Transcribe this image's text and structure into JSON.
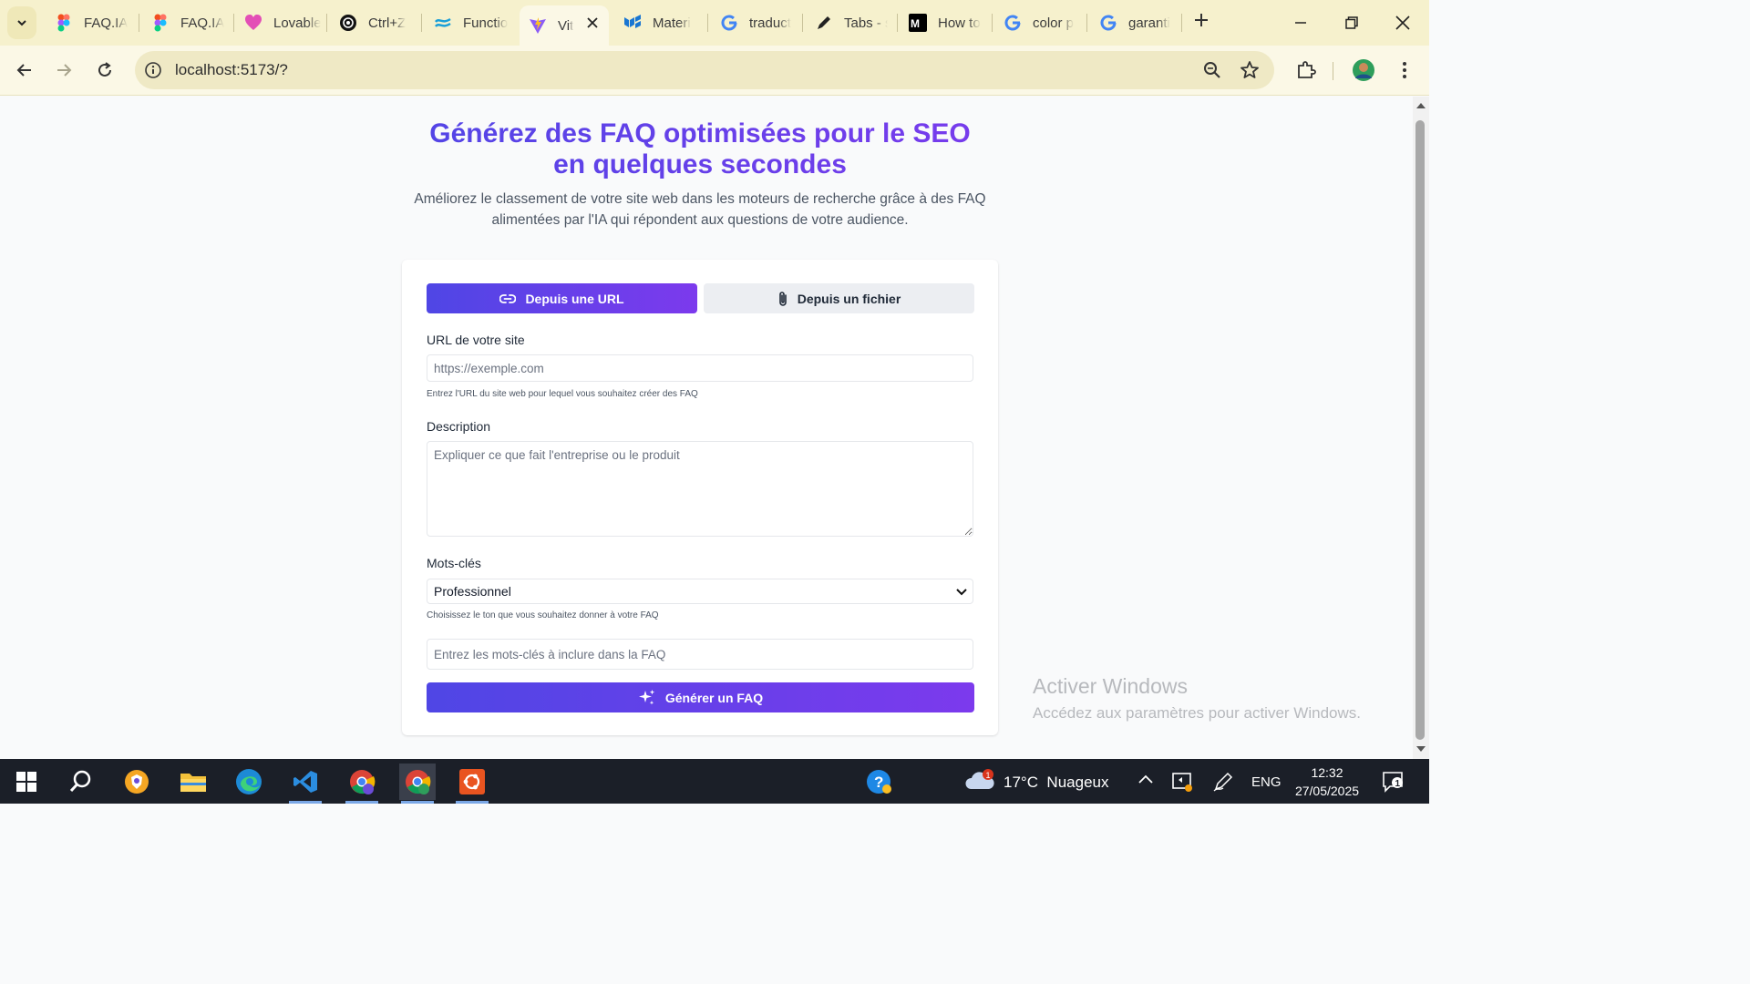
{
  "browser": {
    "tabs": [
      {
        "label": "FAQ.IA",
        "icon": "figma-icon"
      },
      {
        "label": "FAQ.IA",
        "icon": "figma-icon"
      },
      {
        "label": "Lovable",
        "icon": "lovable-icon"
      },
      {
        "label": "Ctrl+Z",
        "icon": "openai-icon"
      },
      {
        "label": "Functio",
        "icon": "wave-icon"
      },
      {
        "label": "Vit",
        "icon": "vite-icon",
        "active": true
      },
      {
        "label": "Materi",
        "icon": "mui-icon"
      },
      {
        "label": "traduct",
        "icon": "google-icon"
      },
      {
        "label": "Tabs - s",
        "icon": "pen-icon"
      },
      {
        "label": "How to",
        "icon": "medium-icon"
      },
      {
        "label": "color p",
        "icon": "google-icon"
      },
      {
        "label": "garanti",
        "icon": "google-icon"
      }
    ],
    "url": "localhost:5173/?"
  },
  "hero": {
    "title_line1": "Générez des FAQ optimisées pour le SEO",
    "title_line2": "en quelques secondes",
    "subtitle_line1": "Améliorez le classement de votre site web dans les moteurs de recherche grâce à des FAQ",
    "subtitle_line2": "alimentées par l'IA qui répondent aux questions de votre audience."
  },
  "form": {
    "tab_url": "Depuis une URL",
    "tab_file": "Depuis un fichier",
    "url_label": "URL de votre site",
    "url_placeholder": "https://exemple.com",
    "url_hint": "Entrez l'URL du site web pour lequel vous souhaitez créer des FAQ",
    "description_label": "Description",
    "description_placeholder": "Expliquer ce que fait l'entreprise ou le produit",
    "keywords_label": "Mots-clés",
    "tone_selected": "Professionnel",
    "tone_hint": "Choisissez le ton que vous souhaitez donner à votre FAQ",
    "keywords_placeholder": "Entrez les mots-clés à inclure dans la FAQ",
    "generate_label": "Générer un FAQ"
  },
  "watermark": {
    "title": "Activer Windows",
    "subtitle": "Accédez aux paramètres pour activer Windows."
  },
  "taskbar": {
    "weather": "17°C  Nuageux",
    "weather_badge": "1",
    "language": "ENG",
    "time": "12:32",
    "date": "27/05/2025",
    "notifications": "1"
  },
  "colors": {
    "accent_start": "#4f46e5",
    "accent_end": "#7c3aed",
    "tabbar": "#f6f1cd",
    "taskbar": "#1b1f28"
  }
}
